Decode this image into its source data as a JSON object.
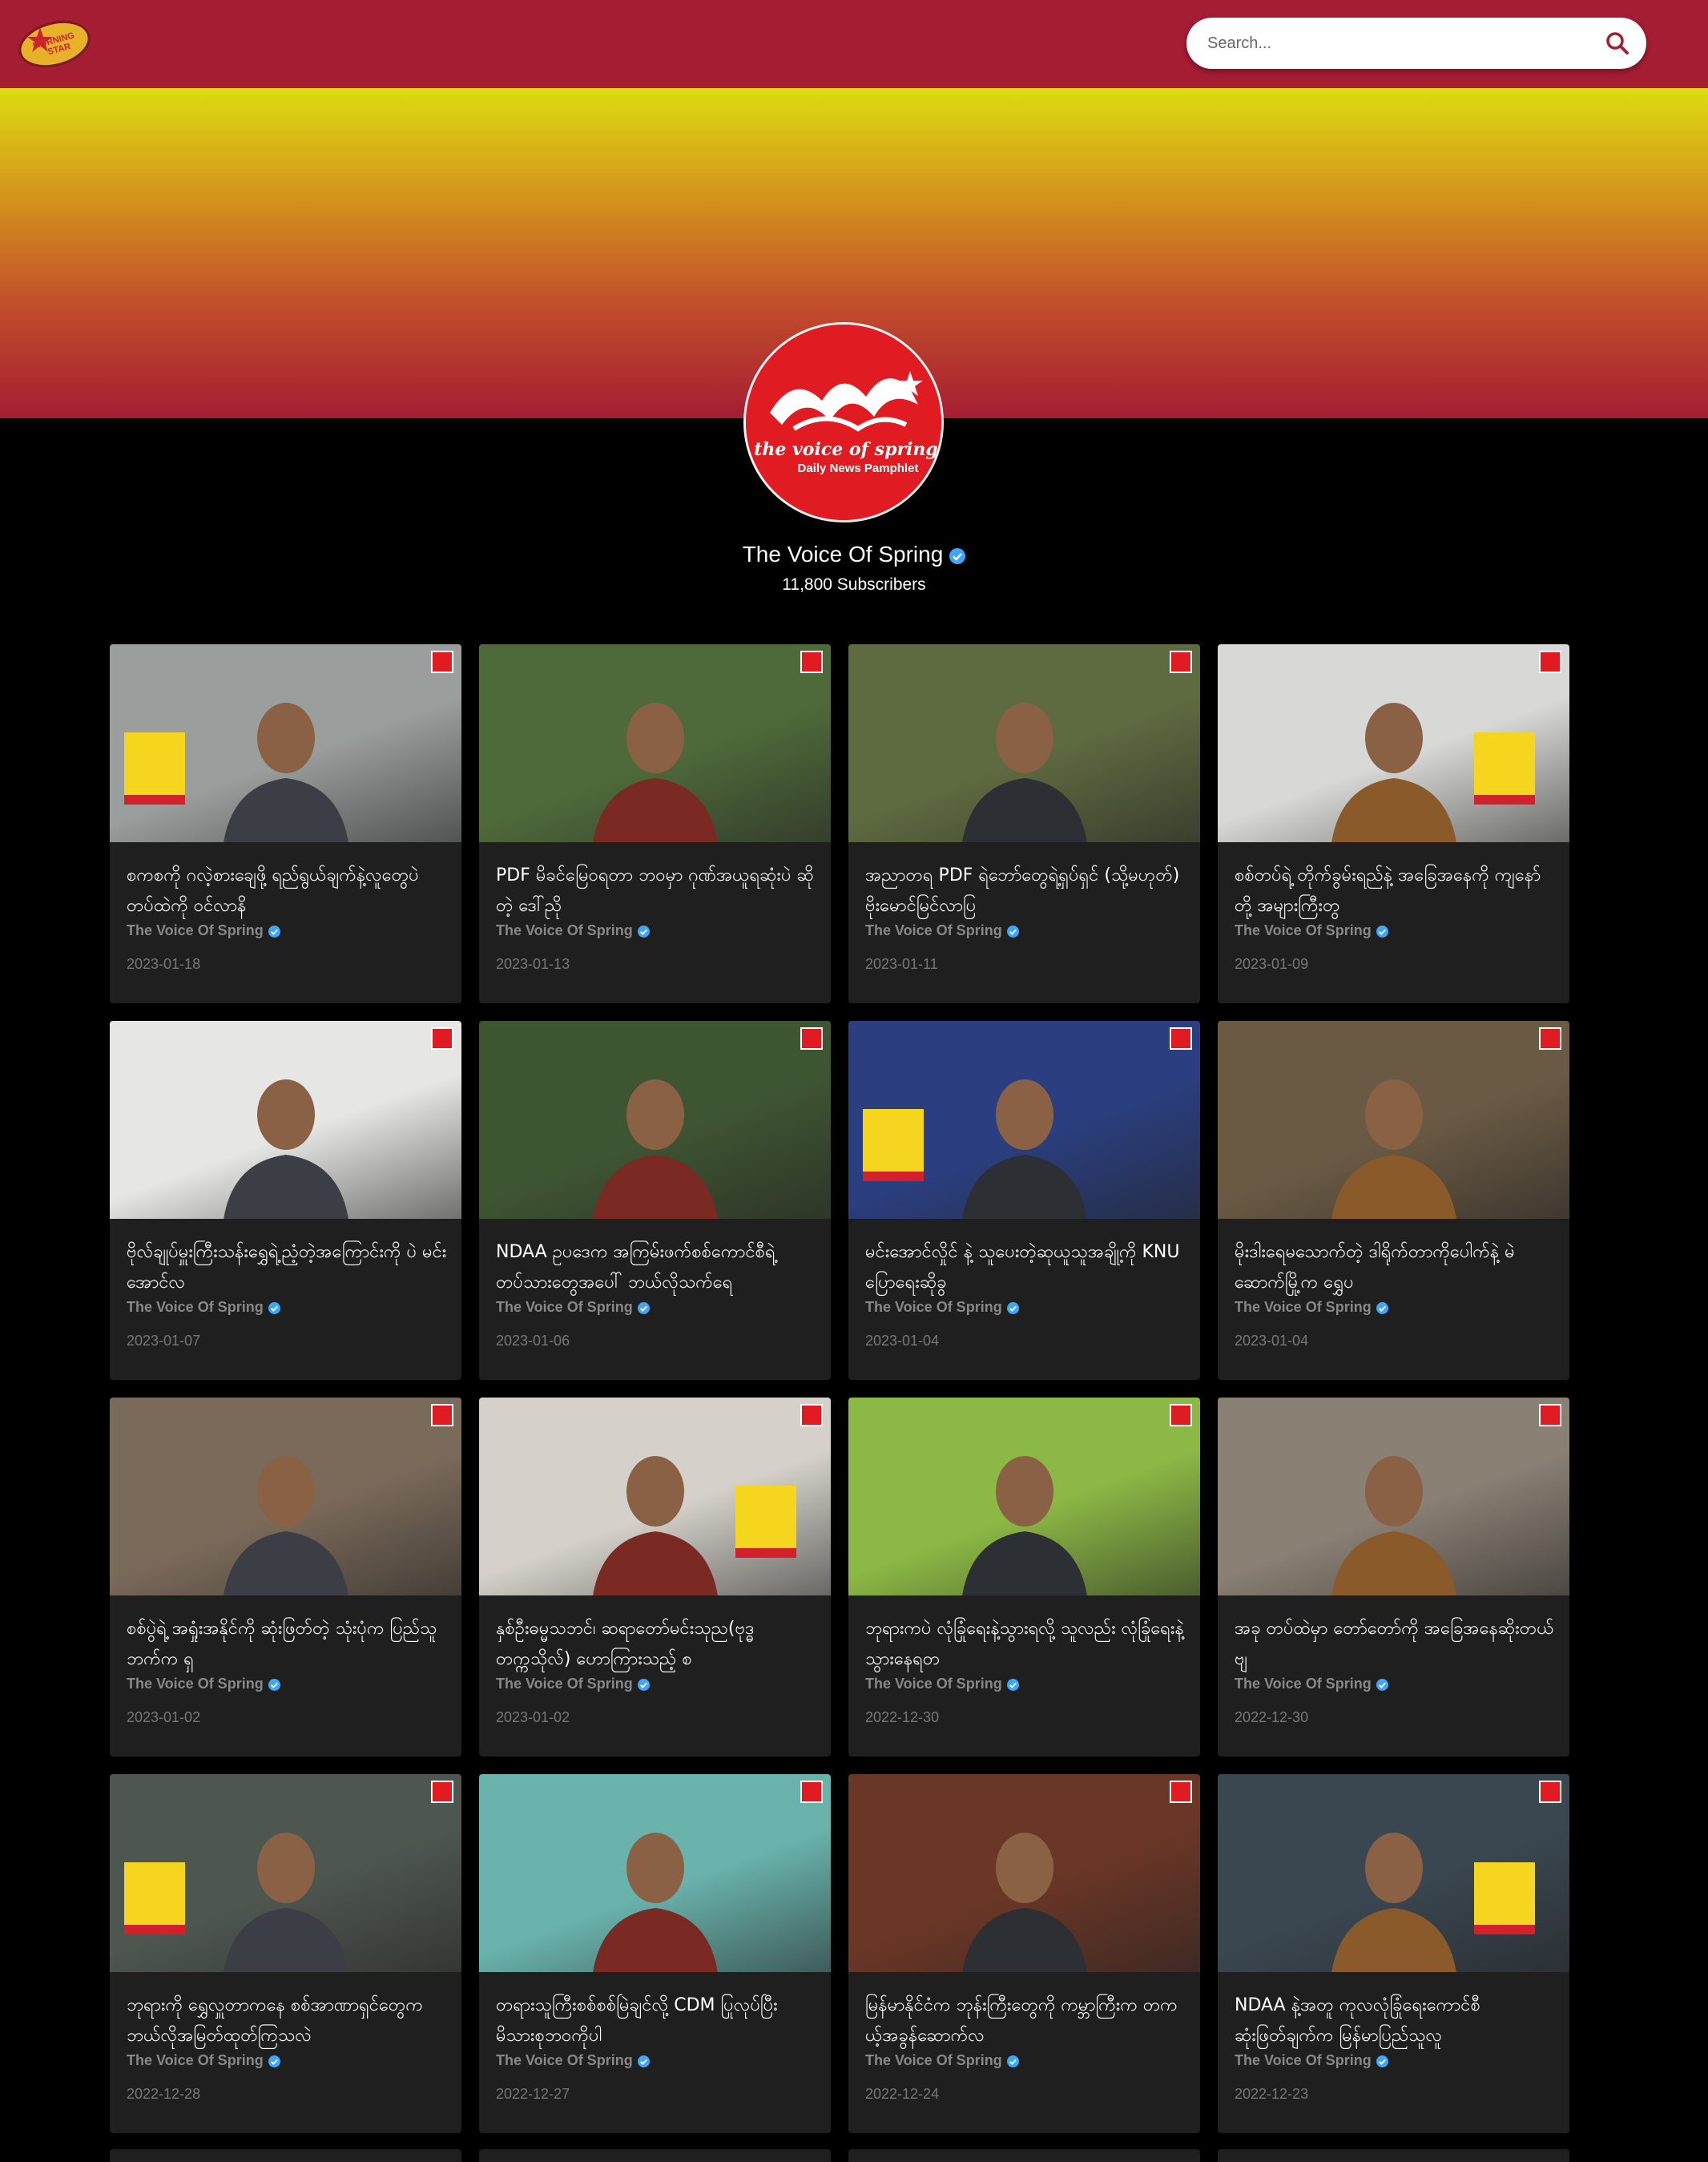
{
  "header": {
    "logo_text": "MORNING STAR",
    "search": {
      "placeholder": "Search...",
      "value": ""
    }
  },
  "channel": {
    "avatar_text_line1": "the voice of spring",
    "avatar_text_line2": "Daily News Pamphlet",
    "name": "The Voice Of Spring",
    "subscribers": "11,800 Subscribers"
  },
  "videos": [
    {
      "title": "စကစကို ဂလဲ့စားချေဖို့ ရည်ရွယ်ချက်နဲ့လူတွေပဲ တပ်ထဲကို ဝင်လာနိ",
      "channel": "The Voice Of Spring",
      "date": "2023-01-18",
      "bg": "#9a9e9c"
    },
    {
      "title": "PDF မိခင်မြေဝရတာ ဘဝမှာ ဂုဏ်အယူရဆုံးပဲ ဆိုတဲ့ ဒေါ်ညို",
      "channel": "The Voice Of Spring",
      "date": "2023-01-13",
      "bg": "#4f6a3a"
    },
    {
      "title": "အညာတရ PDF ရဲဘော်တွေရဲ့ရှပ်ရှင် (သို့မဟုတ်) ဗိုးမောင်မြင်လာပြ",
      "channel": "The Voice Of Spring",
      "date": "2023-01-11",
      "bg": "#5e6a40"
    },
    {
      "title": "စစ်တပ်ရဲ့ တိုက်ခွမ်းရည်နဲ့ အခြေအနေကို ကျနော်တို့ အများကြီးတွ",
      "channel": "The Voice Of Spring",
      "date": "2023-01-09",
      "bg": "#d8d8d6"
    },
    {
      "title": "ဗိုလ်ချုပ်မှူးကြီးသန်းရွှေရဲ့ညံ့တဲ့အကြောင်းကို ပဲ မင်းအောင်လ",
      "channel": "The Voice Of Spring",
      "date": "2023-01-07",
      "bg": "#e6e6e4"
    },
    {
      "title": "NDAA ဥပဒေက အကြမ်းဖက်စစ်ကောင်စီရဲ့ တပ်သားတွေအပေါ် ဘယ်လိုသက်ရေ",
      "channel": "The Voice Of Spring",
      "date": "2023-01-06",
      "bg": "#3e5532"
    },
    {
      "title": "မင်းအောင်လှိုင် နဲ့ သူပေးတဲ့ဆုယူသူအချို့ကို KNU ပြောရေးဆိုခွ",
      "channel": "The Voice Of Spring",
      "date": "2023-01-04",
      "bg": "#2b3f80"
    },
    {
      "title": "မိုးဒါးရေမသောက်တဲ့ ဒါရိုက်တာကိုပေါက်နဲ့ မဲဆောက်မြို့က ရွှေပ",
      "channel": "The Voice Of Spring",
      "date": "2023-01-04",
      "bg": "#6a5a44"
    },
    {
      "title": "စစ်ပွဲရဲ့ အရှုံးအနိုင်ကို ဆုံးဖြတ်တဲ့ သုံးပုံက ပြည်သူဘက်က ရှ",
      "channel": "The Voice Of Spring",
      "date": "2023-01-02",
      "bg": "#7a6a5a"
    },
    {
      "title": "နှစ်ဦးဓမ္မသဘင်၊ ဆရာတော်မင်းသုည(ဗုဒ္ဓတက္ကသိုလ်) ဟောကြားသည့် စ",
      "channel": "The Voice Of Spring",
      "date": "2023-01-02",
      "bg": "#d5d1ca"
    },
    {
      "title": "ဘုရားကပဲ လုံခြုံရေးနဲ့သွားရလို့ သူလည်း လုံခြုံရေးနဲ့သွားနေရတ",
      "channel": "The Voice Of Spring",
      "date": "2022-12-30",
      "bg": "#8cb845"
    },
    {
      "title": "အခု တပ်ထဲမှာ တော်တော်ကို အခြေအနေဆိုးတယ်ဗျ",
      "channel": "The Voice Of Spring",
      "date": "2022-12-30",
      "bg": "#8a8074"
    },
    {
      "title": "ဘုရားကို ရွှေလှူတာကနေ စစ်အာဏာရှင်တွေက ဘယ်လိုအမြတ်ထုတ်ကြသလဲ",
      "channel": "The Voice Of Spring",
      "date": "2022-12-28",
      "bg": "#4e5650"
    },
    {
      "title": "တရားသူကြီးစစ်စစ်မြဲချင်လို့ CDM ပြုလုပ်ပြီး မိသားစုဘဝကိုပါ",
      "channel": "The Voice Of Spring",
      "date": "2022-12-27",
      "bg": "#6ab3ad"
    },
    {
      "title": "မြန်မာနိုင်ငံက ဘုန်းကြီးတွေကို ကမ္ဘာကြီးက တကယ့်အခွန်ဆောက်လ",
      "channel": "The Voice Of Spring",
      "date": "2022-12-24",
      "bg": "#6a3626"
    },
    {
      "title": "NDAA နဲ့အတူ ကုလလုံခြုံရေးကောင်စီ ဆုံးဖြတ်ချက်က မြန်မာပြည်သူလူ",
      "channel": "The Voice Of Spring",
      "date": "2022-12-23",
      "bg": "#3a4650"
    }
  ],
  "colors": {
    "header_bg": "#a51d33",
    "banner_top": "#dcdc10",
    "banner_bottom": "#a51d33",
    "card_bg": "#1f1f1f",
    "verified_blue": "#3ea6ff",
    "avatar_red": "#e01b22"
  }
}
